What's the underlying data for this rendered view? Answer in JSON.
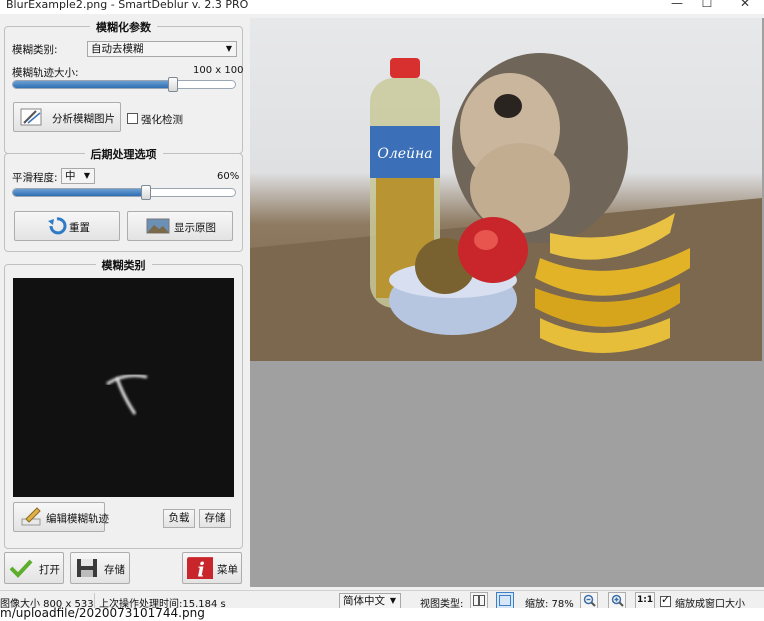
{
  "window": {
    "title": "BlurExample2.png - SmartDeblur v. 2.3 PRO",
    "minimize": "—",
    "maximize": "☐",
    "close": "✕"
  },
  "blur_params": {
    "title": "模糊化参数",
    "type_label": "模糊类别:",
    "type_value": "自动去模糊",
    "size_label": "模糊轨迹大小:",
    "size_value": "100 x 100",
    "size_fraction": 0.72,
    "analyze_label": "分析模糊图片",
    "enhance_label": "强化检测",
    "enhance_checked": false
  },
  "post": {
    "title": "后期处理选项",
    "smooth_label": "平滑程度:",
    "smooth_value": "中",
    "smooth_percent_text": "60%",
    "smooth_fraction": 0.6,
    "reset_label": "重置",
    "show_original_label": "显示原图"
  },
  "kernel": {
    "title": "模糊类别",
    "edit_label": "编辑模糊轨迹",
    "load_label": "负载",
    "save_label": "存储"
  },
  "bottom": {
    "open_label": "打开",
    "save_label": "存储",
    "menu_label": "菜单"
  },
  "status": {
    "image_size": "图像大小 800 x 533",
    "last_op": "上次操作处理时间:15.184 s",
    "language": "简体中文",
    "view_type_label": "视图类型:",
    "zoom_label": "缩放: 78%",
    "one_to_one": "1:1",
    "fit_label": "缩放成窗口大小",
    "fit_checked": true
  },
  "url": "m/uploadfile/2020073101744.png",
  "colors": {
    "accent": "#2f6fb3",
    "menu_red": "#c8262a",
    "canvas_gray": "#a0a0a0"
  }
}
